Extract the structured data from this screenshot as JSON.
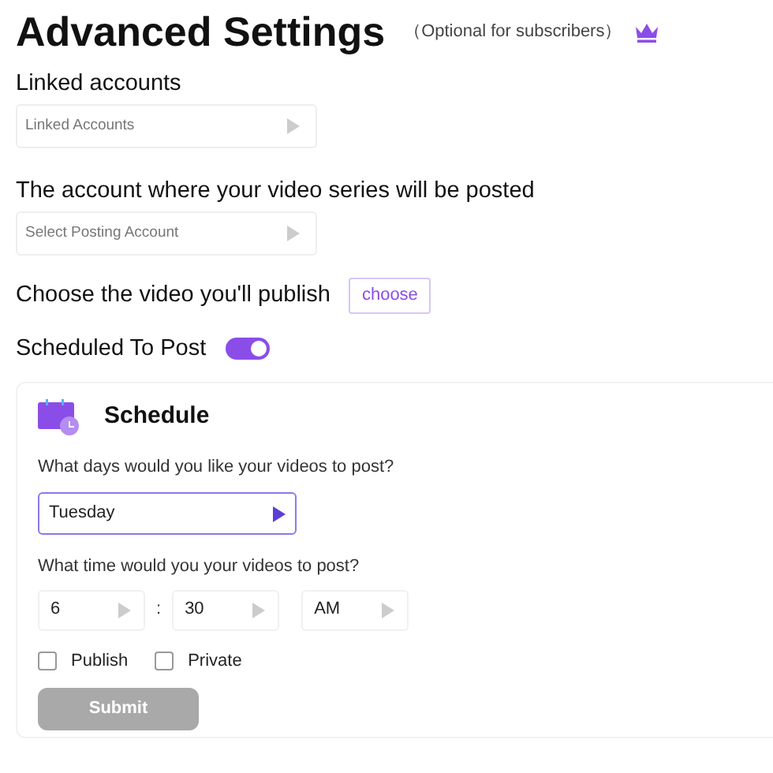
{
  "header": {
    "title": "Advanced Settings",
    "note": "（Optional for subscribers）"
  },
  "linked_accounts": {
    "label": "Linked accounts",
    "select": {
      "placeholder": "Linked Accounts"
    }
  },
  "posting_account": {
    "label": "The account where your video series will be posted",
    "select": {
      "placeholder": "Select Posting Account"
    }
  },
  "video": {
    "label": "Choose the video you'll publish",
    "button": "choose"
  },
  "scheduled": {
    "label": "Scheduled To Post",
    "on": true
  },
  "schedule": {
    "title": "Schedule",
    "days_question": "What days would you like your videos to post?",
    "day_select": {
      "value": "Tuesday",
      "focused": true
    },
    "time_question": "What time would you your videos to post?",
    "time": {
      "hour": "6",
      "separator": ":",
      "minute": "30",
      "period": "AM"
    },
    "checkboxes": [
      {
        "label": "Publish",
        "checked": false
      },
      {
        "label": "Private",
        "checked": false
      }
    ],
    "submit": {
      "label": "Submit",
      "disabled": true
    }
  }
}
